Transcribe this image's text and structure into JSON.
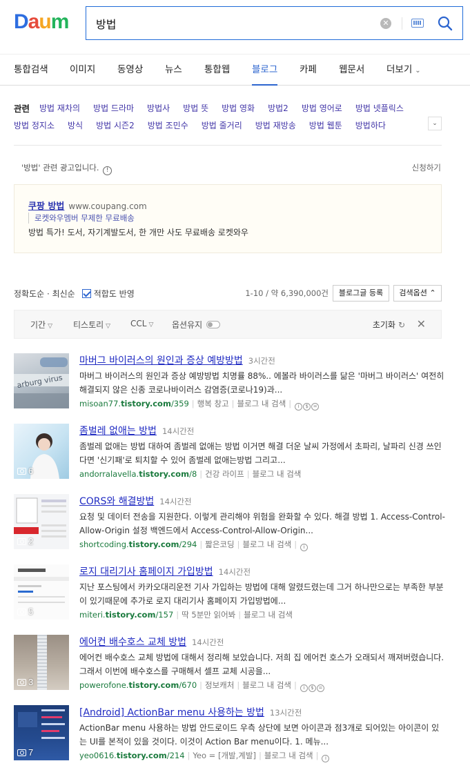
{
  "header": {
    "logo_letters": [
      "D",
      "a",
      "u",
      "m"
    ],
    "logo_colors": [
      "#2e6ee0",
      "#e64b3c",
      "#f5a623",
      "#23b35b"
    ],
    "search_query": "방법"
  },
  "tabs": [
    {
      "label": "통합검색",
      "active": false
    },
    {
      "label": "이미지",
      "active": false
    },
    {
      "label": "동영상",
      "active": false
    },
    {
      "label": "뉴스",
      "active": false
    },
    {
      "label": "통합웹",
      "active": false
    },
    {
      "label": "블로그",
      "active": true
    },
    {
      "label": "카페",
      "active": false
    },
    {
      "label": "웹문서",
      "active": false
    },
    {
      "label": "더보기",
      "active": false
    }
  ],
  "related": {
    "label": "관련",
    "row1": [
      "방법 재차의",
      "방법 드라마",
      "방법사",
      "방법 뜻",
      "방법 영화",
      "방법2",
      "방법 영어로",
      "방법 넷플릭스"
    ],
    "row2": [
      "방법 정지소",
      "방식",
      "방법 시즌2",
      "방법 조민수",
      "방법 줄거리",
      "방법 재방송",
      "방법 웹툰",
      "방법하다"
    ]
  },
  "ad": {
    "header": "'방법' 관련 광고입니다.",
    "apply": "신청하기",
    "title": "쿠팡 방법",
    "url": "www.coupang.com",
    "sub": "로켓와우멤버 무제한 무료배송",
    "desc": "방법 특가! 도서, 자기계발도서, 한 개만 사도 무료배송 로켓와우"
  },
  "sortbar": {
    "sort": "정확도순 · 최신순",
    "relevance": "적합도 반영",
    "count": "1-10 / 약 6,390,000건",
    "register": "블로그글 등록",
    "options": "검색옵션"
  },
  "filters": {
    "period": "기간",
    "tistory": "티스토리",
    "ccl": "CCL",
    "keep": "옵션유지",
    "reset": "초기화"
  },
  "results": [
    {
      "title": "마버그 바이러스의 원인과 증상 예방방법",
      "time": "3시간전",
      "desc": "마버그 바이러스의 원인과 증상 예방방법 치명률 88%.. 에볼라 바이러스를 닮은 '마버그 바이러스' 여전히 해결되지 않은 신종 코로나바이러스 감염증(코로나19)과...",
      "domain_pre": "misoan77.",
      "domain_bold": "tistory.com",
      "domain_post": "/359",
      "blog": "행복 창고",
      "inblog": "블로그 내 검색",
      "photos": ""
    },
    {
      "title": "좀벌레 없애는 방법",
      "time": "14시간전",
      "desc": "좀벌레 없애는 방법 대하여 좀벌레 없애는 방법 이거면 해결 더운 날씨 가정에서 초파리, 날파리 신경 쓰인다면 '신기패'로 퇴치할 수 있어 좀벌레 없애는방법 그리고...",
      "domain_pre": "andorralavella.",
      "domain_bold": "tistory.com",
      "domain_post": "/8",
      "blog": "건강 라이프",
      "inblog": "블로그 내 검색",
      "photos": "6"
    },
    {
      "title": "CORS와 해결방법",
      "time": "14시간전",
      "desc": "요청 및 데이터 전송을 지원한다. 이렇게 관리해야 위험을 완화할 수 있다. 해결 방법 1. Access-Control-Allow-Origin 설정 백엔드에서 Access-Control-Allow-Origin...",
      "domain_pre": "shortcoding.",
      "domain_bold": "tistory.com",
      "domain_post": "/294",
      "blog": "짧은코딩",
      "inblog": "블로그 내 검색",
      "photos": "2"
    },
    {
      "title": "로지 대리기사 홈페이지 가입방법",
      "time": "14시간전",
      "desc": "지난 포스팅에서 카카오대리운전 기사 가입하는 방법에 대해 알렸드렸는데 그거 하나만으로는 부족한 부분이 있기때문에 추가로 로지 대리기사 홈페이지 가입방법에...",
      "domain_pre": "miteri.",
      "domain_bold": "tistory.com",
      "domain_post": "/157",
      "blog": "딱 5분만 읽어봐",
      "inblog": "블로그 내 검색",
      "photos": "5"
    },
    {
      "title": "에어컨 배수호스 교체 방법",
      "time": "14시간전",
      "desc": "에어컨 배수호스 교체 방법에 대해서 정리해 보았습니다. 저희 집 에어컨 호스가 오래되서 깨져버렸습니다. 그래서 이번에 배수호스를 구매해서 셀프 교체 시공을...",
      "domain_pre": "powerofone.",
      "domain_bold": "tistory.com",
      "domain_post": "/670",
      "blog": "정보캐처",
      "inblog": "블로그 내 검색",
      "photos": "3"
    },
    {
      "title": "[Android] ActionBar menu 사용하는 방법",
      "time": "13시간전",
      "desc": "ActionBar menu 사용하는 방법 안드로이드 우측 상단에 보면 아이콘과 점3개로 되어있는 아이콘이 있는 UI를 본적이 있을 것이다. 이것이 Action Bar menu이다. 1. 메뉴...",
      "domain_pre": "yeo0616.",
      "domain_bold": "tistory.com",
      "domain_post": "/214",
      "blog": "Yeo = [개발,계발]",
      "inblog": "블로그 내 검색",
      "photos": "7"
    }
  ]
}
